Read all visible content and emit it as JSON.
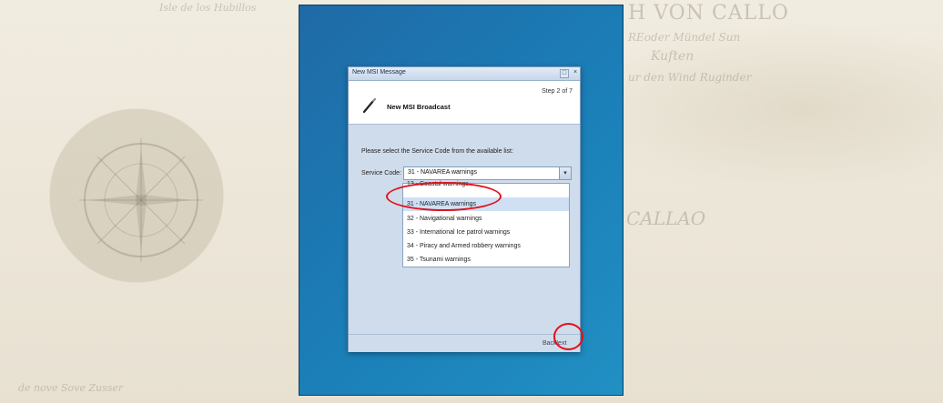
{
  "background_map": {
    "title": "H    VON CALLO",
    "line1": "REoder Mündel Sun",
    "line2": "Kuften",
    "line3": "ur den Wind Ruginder",
    "line4": "CALLAO",
    "top_left": "Isle de los Hubillos",
    "bottom_left": "de nove Sove Zusser"
  },
  "window": {
    "title": "New MSI Message",
    "restore_glyph": "□",
    "close_glyph": "×"
  },
  "header": {
    "step": "Step 2 of 7",
    "title": "New MSI Broadcast"
  },
  "form": {
    "prompt": "Please select the Service Code from the available list:",
    "service_code_label": "Service Code:",
    "service_code_value": "31 - NAVAREA warnings",
    "dropdown_arrow": "▾",
    "options": [
      "13 - Coastal warnings",
      "31 - NAVAREA warnings",
      "32 - Navigational warnings",
      "33 - International Ice patrol warnings",
      "34 - Piracy and Armed robbery warnings",
      "35 - Tsunami warnings"
    ],
    "selected_index": 1
  },
  "footer": {
    "back_label": "Back",
    "next_label": "Next"
  },
  "colors": {
    "desktop": "#1b7fb8",
    "dialog": "#cfdcec",
    "annotation": "#e3121a"
  }
}
